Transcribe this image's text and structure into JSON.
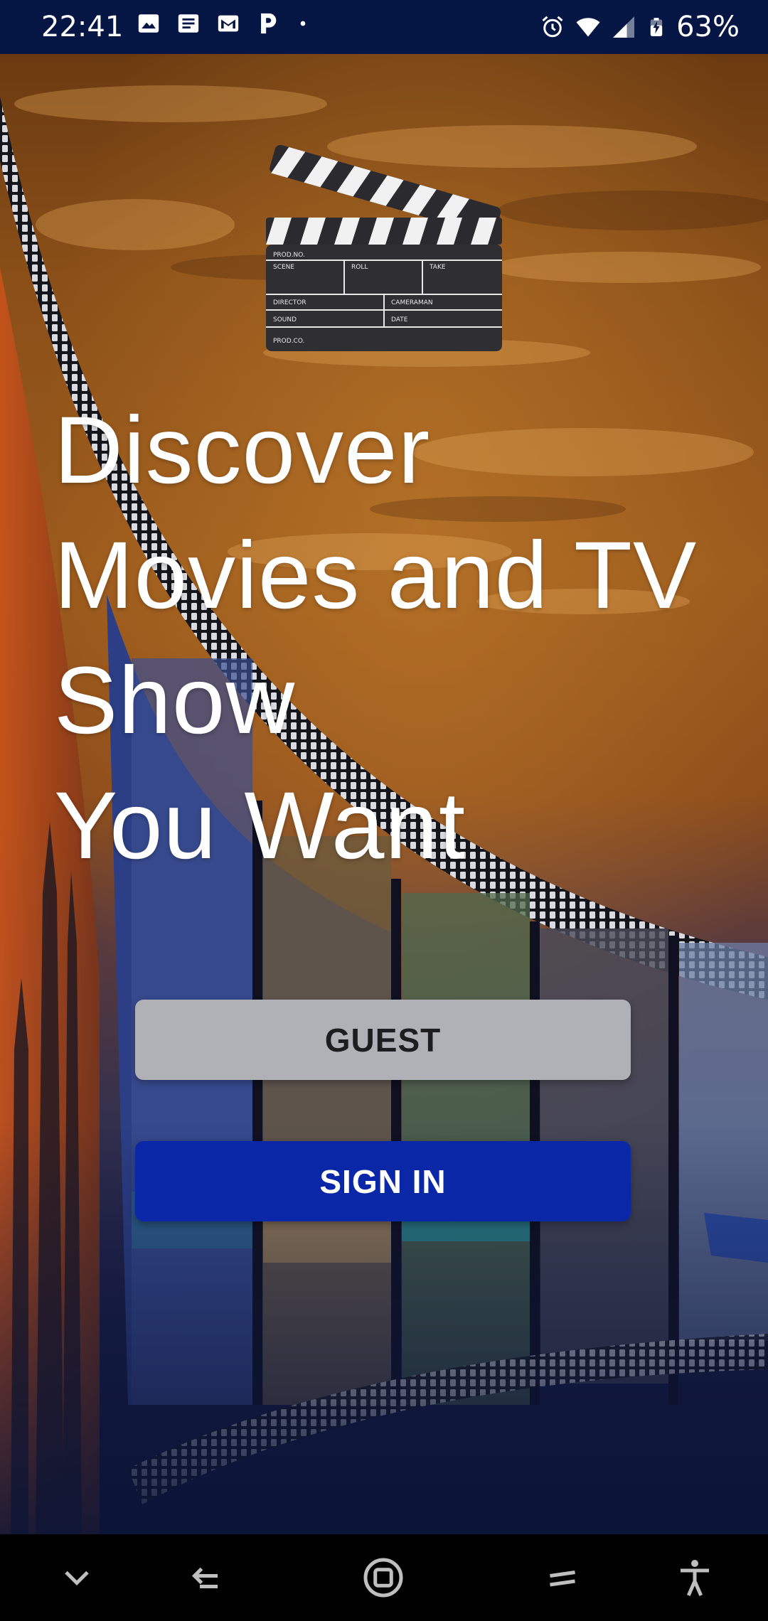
{
  "status_bar": {
    "time": "22:41",
    "left_icons": [
      "image-icon",
      "news-icon",
      "gmail-icon",
      "pandora-icon",
      "dot-icon"
    ],
    "right_icons": [
      "alarm-icon",
      "wifi-icon",
      "signal-icon",
      "battery-charging-icon"
    ],
    "battery_percent": "63%"
  },
  "hero": {
    "logo_icon": "clapperboard-icon",
    "clapper_text": {
      "prod_no": "PROD.NO.",
      "scene": "SCENE",
      "roll": "ROLL",
      "take": "TAKE",
      "director": "DIRECTOR",
      "cameraman": "CAMERAMAN",
      "sound": "SOUND",
      "date": "DATE",
      "prod_co": "PROD.CO."
    },
    "headline_lines": [
      "Discover",
      "Movies and TV",
      "Show",
      "You Want"
    ]
  },
  "actions": {
    "guest_label": "GUEST",
    "signin_label": "SIGN IN"
  },
  "nav_bar": {
    "icons": [
      "chevron-down-icon",
      "back-icon",
      "home-icon",
      "recents-icon",
      "accessibility-icon"
    ]
  },
  "colors": {
    "status_bar_bg": "#061644",
    "guest_button": "#b0b1b7",
    "signin_button": "#0a27a8",
    "nav_bar_bg": "#000000"
  }
}
